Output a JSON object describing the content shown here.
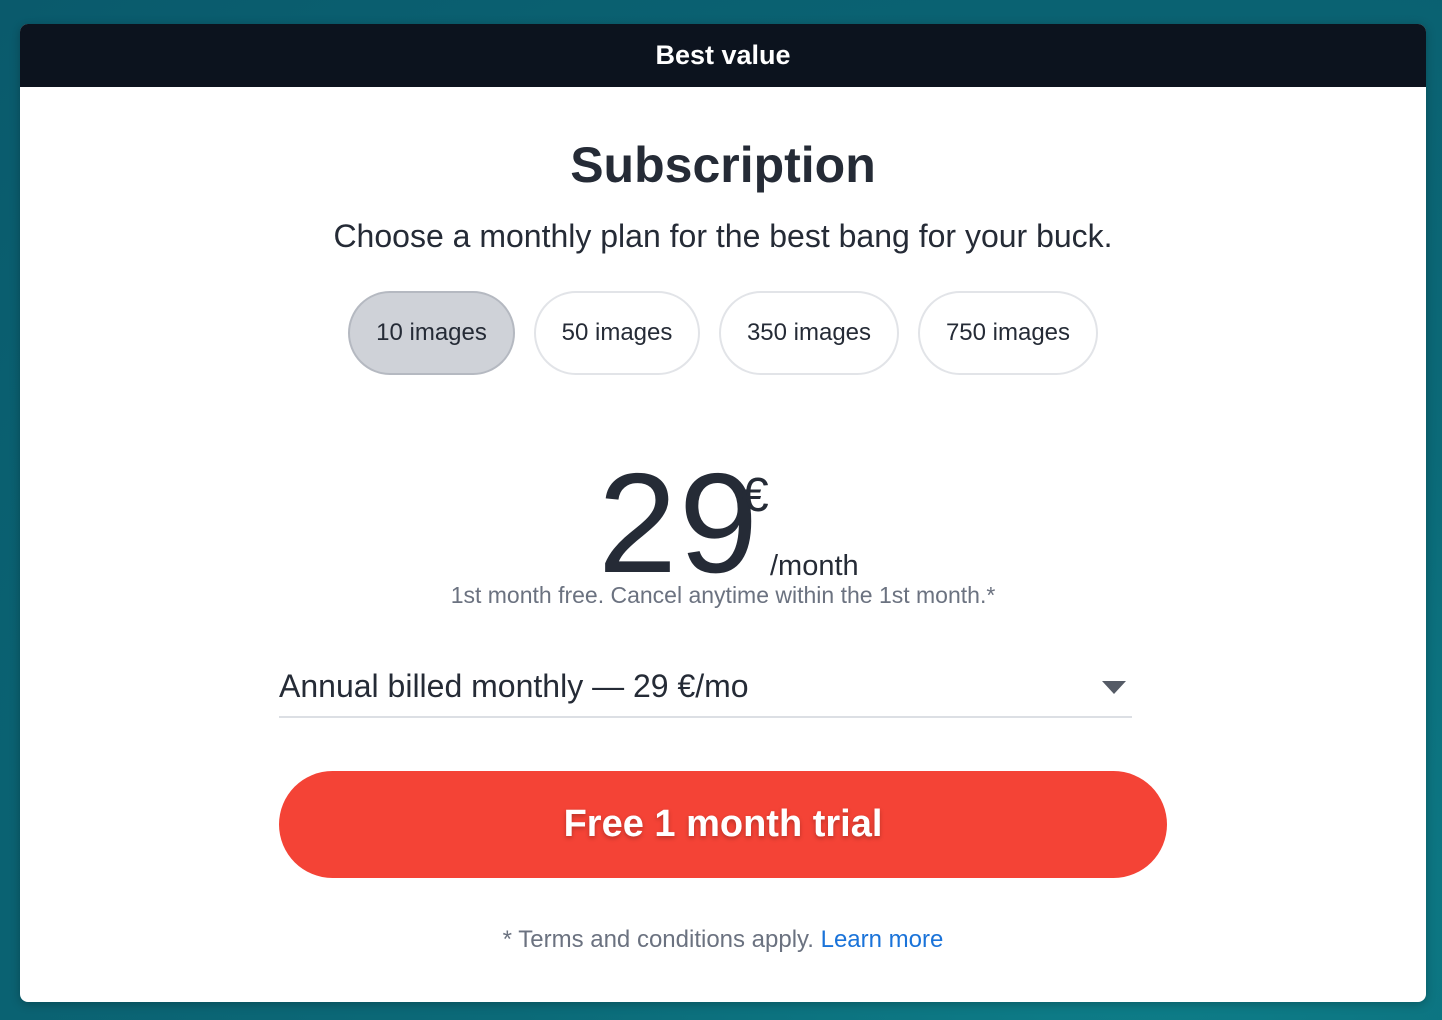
{
  "banner": {
    "label": "Best value"
  },
  "header": {
    "title": "Subscription",
    "subtitle": "Choose a monthly plan for the best bang for your buck."
  },
  "plans": [
    {
      "label": "10 images",
      "selected": true
    },
    {
      "label": "50 images",
      "selected": false
    },
    {
      "label": "350 images",
      "selected": false
    },
    {
      "label": "750 images",
      "selected": false
    }
  ],
  "price": {
    "amount": "29",
    "currency": "€",
    "period": "/month",
    "note": "1st month free. Cancel anytime within the 1st month.*"
  },
  "billing": {
    "selected": "Annual billed monthly — 29 €/mo"
  },
  "cta": {
    "label": "Free 1 month trial"
  },
  "terms": {
    "text": "* Terms and conditions apply.",
    "link_label": "Learn more"
  },
  "colors": {
    "banner_bg": "#0c131e",
    "cta_bg": "#f44336",
    "link": "#1a73d9",
    "selected_pill": "#cfd2d8"
  }
}
